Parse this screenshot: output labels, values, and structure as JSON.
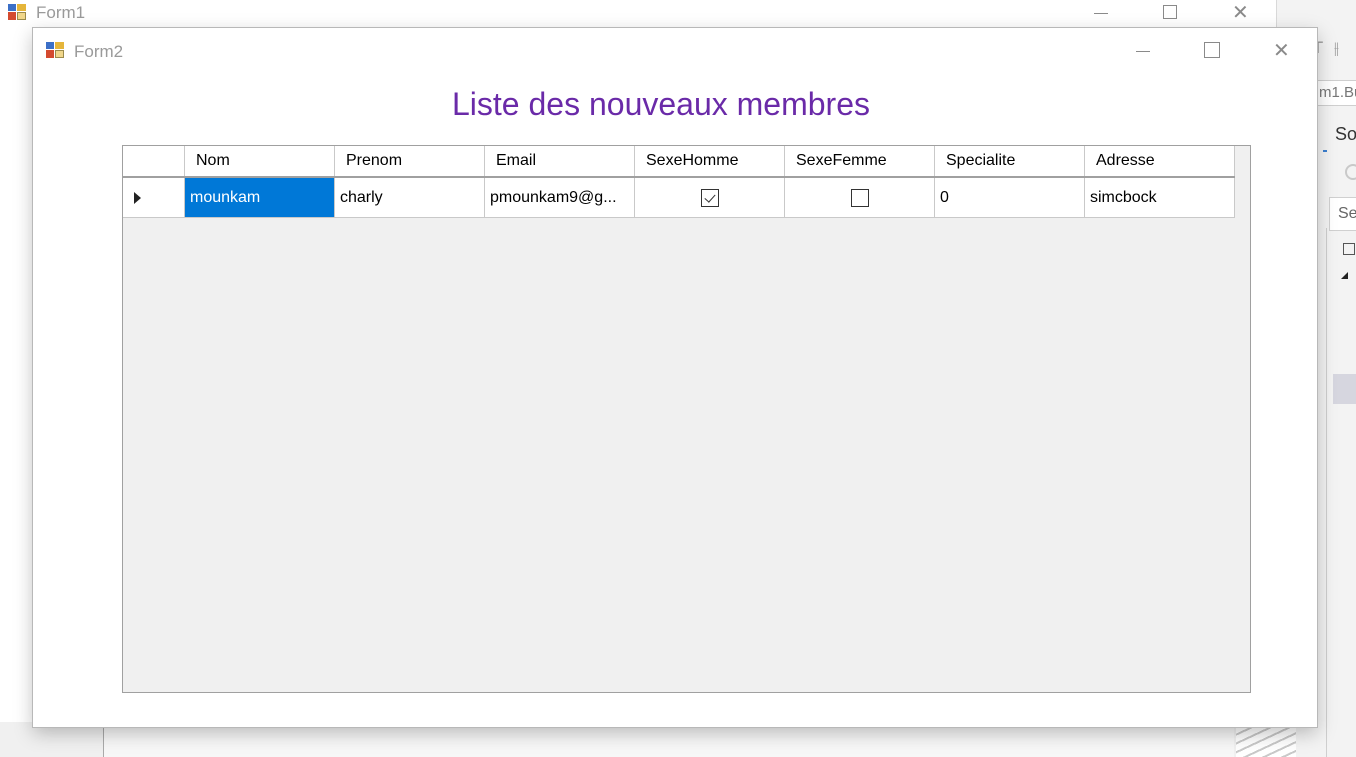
{
  "form1": {
    "title": "Form1"
  },
  "ide": {
    "tab_text": "m1.Bu",
    "panel_title": "So",
    "search_text": "Se",
    "toolbar_glyphs": "T ⫲"
  },
  "form2": {
    "title": "Form2",
    "heading": "Liste des nouveaux membres",
    "grid": {
      "columns": [
        "Nom",
        "Prenom",
        "Email",
        "SexeHomme",
        "SexeFemme",
        "Specialite",
        "Adresse"
      ],
      "rows": [
        {
          "nom": "mounkam",
          "prenom": "charly",
          "email": "pmounkam9@g...",
          "sexe_homme": true,
          "sexe_femme": false,
          "specialite": "0",
          "adresse": "simcbock"
        }
      ],
      "selected_cell": "nom",
      "current_row_indicator": "triangle-right"
    }
  },
  "colors": {
    "heading": "#6a2aa8",
    "selection": "#0078d7"
  },
  "icons": {
    "window_minimize": "minimize-icon",
    "window_maximize": "maximize-icon",
    "window_close": "close-icon",
    "app": "winforms-app-icon",
    "checkbox_checked": "checkbox-checked-icon",
    "checkbox_unchecked": "checkbox-unchecked-icon",
    "row_indicator": "current-row-arrow-icon"
  }
}
